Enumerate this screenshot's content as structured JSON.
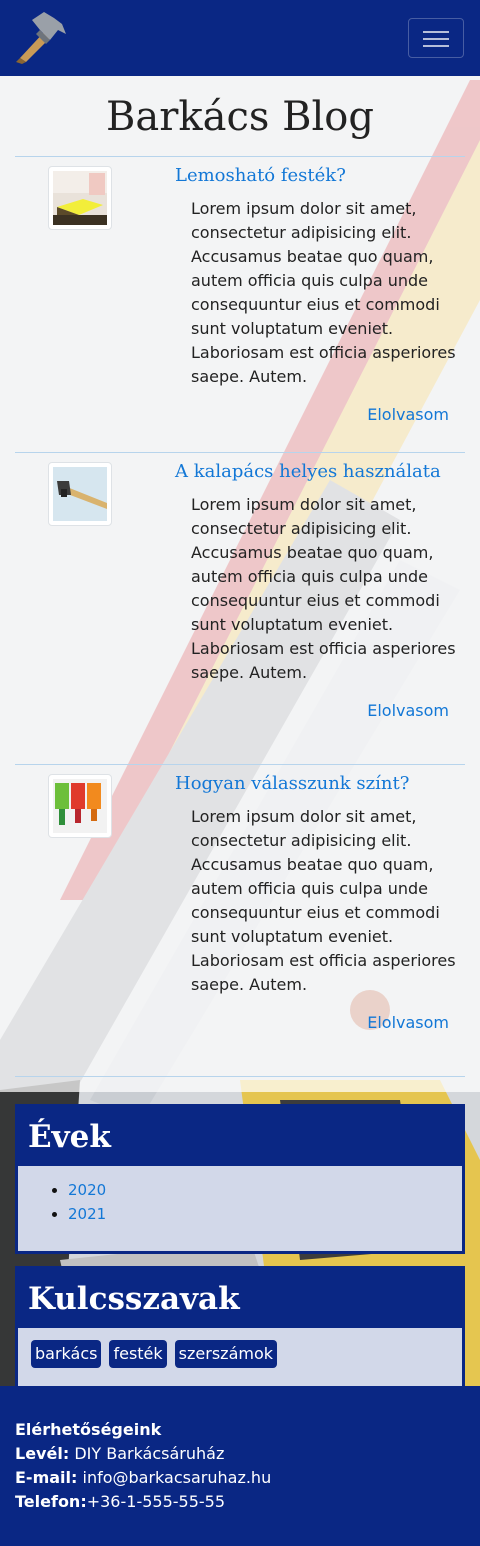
{
  "nav": {
    "brand_icon": "hammer-icon",
    "toggle_icon": "hamburger-icon"
  },
  "page": {
    "title": "Barkács Blog"
  },
  "posts": [
    {
      "title": "Lemosható festék?",
      "body": "Lorem ipsum dolor sit amet, consectetur adipisicing elit. Accusamus beatae quo quam, autem officia quis culpa unde consequuntur eius et commodi sunt voluptatum eveniet. Laboriosam est officia asperiores saepe. Autem.",
      "link": "Elolvasom"
    },
    {
      "title": "A kalapács helyes használata",
      "body": "Lorem ipsum dolor sit amet, consectetur adipisicing elit. Accusamus beatae quo quam, autem officia quis culpa unde consequuntur eius et commodi sunt voluptatum eveniet. Laboriosam est officia asperiores saepe. Autem.",
      "link": "Elolvasom"
    },
    {
      "title": "Hogyan válasszunk színt?",
      "body": "Lorem ipsum dolor sit amet, consectetur adipisicing elit. Accusamus beatae quo quam, autem officia quis culpa unde consequuntur eius et commodi sunt voluptatum eveniet. Laboriosam est officia asperiores saepe. Autem.",
      "link": "Elolvasom"
    }
  ],
  "years": {
    "title": "Évek",
    "items": [
      "2020",
      "2021"
    ]
  },
  "keywords": {
    "title": "Kulcsszavak",
    "items": [
      "barkács",
      "festék",
      "szerszámok"
    ]
  },
  "footer": {
    "heading": "Elérhetőségeink",
    "mail_label": "Levél:",
    "mail_value": "DIY Barkácsáruház",
    "email_label": "E-mail:",
    "email_value": "info@barkacsaruhaz.hu",
    "phone_label": "Telefon:",
    "phone_value": "+36-1-555-55-55"
  },
  "colors": {
    "brand": "#0a2784",
    "link": "#1277d6",
    "divider": "#b7d4ec"
  }
}
